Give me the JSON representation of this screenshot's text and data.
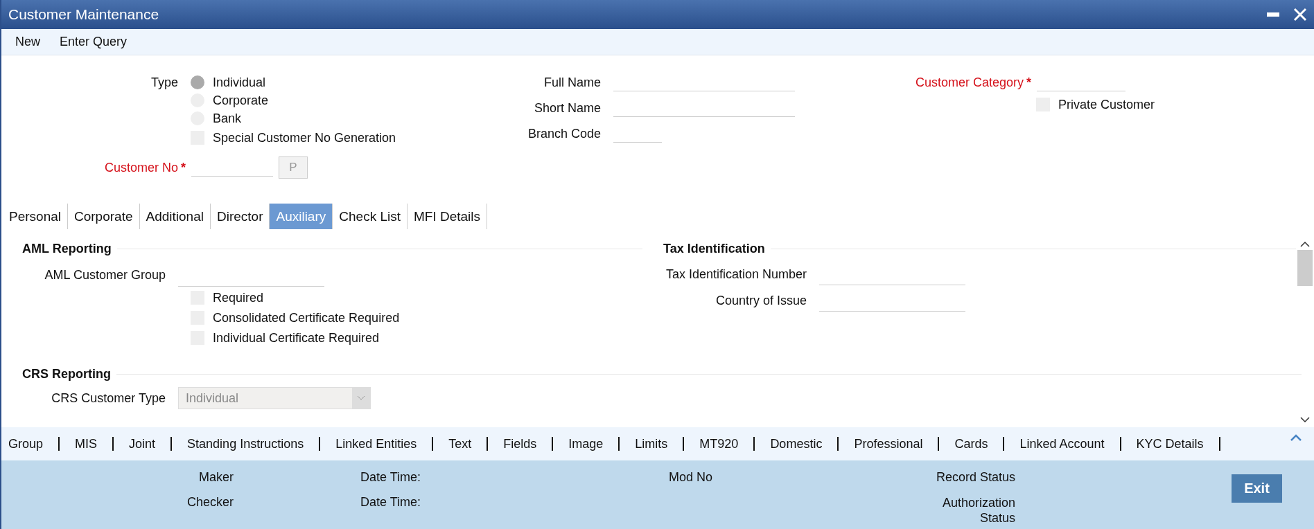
{
  "window": {
    "title": "Customer Maintenance"
  },
  "toolbar": [
    "New",
    "Enter Query"
  ],
  "header": {
    "type_label": "Type",
    "type_options": [
      {
        "label": "Individual",
        "selected": true
      },
      {
        "label": "Corporate",
        "selected": false
      },
      {
        "label": "Bank",
        "selected": false
      }
    ],
    "special_generation": {
      "label": "Special Customer No Generation",
      "checked": false
    },
    "customer_no": {
      "label": "Customer No",
      "marker": "*",
      "button": {
        "label": "P",
        "disabled": true
      }
    },
    "name_fields": [
      {
        "label": "Full Name"
      },
      {
        "label": "Short Name"
      },
      {
        "label": "Branch Code"
      }
    ],
    "customer_category": {
      "label": "Customer Category",
      "marker": "*"
    },
    "private_customer": {
      "label": "Private Customer",
      "checked": false
    }
  },
  "tabs": [
    {
      "label": "Personal",
      "selected": false
    },
    {
      "label": "Corporate",
      "selected": false
    },
    {
      "label": "Additional",
      "selected": false
    },
    {
      "label": "Director",
      "selected": false
    },
    {
      "label": "Auxiliary",
      "selected": true
    },
    {
      "label": "Check List",
      "selected": false
    },
    {
      "label": "MFI Details",
      "selected": false
    }
  ],
  "aml": {
    "title": "AML Reporting",
    "group_label": "AML Customer Group",
    "checkboxes": [
      {
        "label": "Required",
        "checked": false
      },
      {
        "label": "Consolidated Certificate Required",
        "checked": false
      },
      {
        "label": "Individual Certificate Required",
        "checked": false
      }
    ]
  },
  "tax": {
    "title": "Tax Identification",
    "fields": [
      {
        "label": "Tax Identification Number"
      },
      {
        "label": "Country of Issue"
      }
    ]
  },
  "crs": {
    "title": "CRS Reporting",
    "customer_type": {
      "label": "CRS Customer Type",
      "value": "Individual",
      "disabled": true
    }
  },
  "footer_links": [
    "Group",
    "MIS",
    "Joint",
    "Standing Instructions",
    "Linked Entities",
    "Text",
    "Fields",
    "Image",
    "Limits",
    "MT920",
    "Domestic",
    "Professional",
    "Cards",
    "Linked Account",
    "KYC Details"
  ],
  "audit": {
    "maker": "Maker",
    "checker": "Checker",
    "date_time_1": "Date Time:",
    "date_time_2": "Date Time:",
    "mod_no": "Mod No",
    "record_status": "Record Status",
    "authorization_status": "Authorization Status",
    "exit": "Exit"
  }
}
